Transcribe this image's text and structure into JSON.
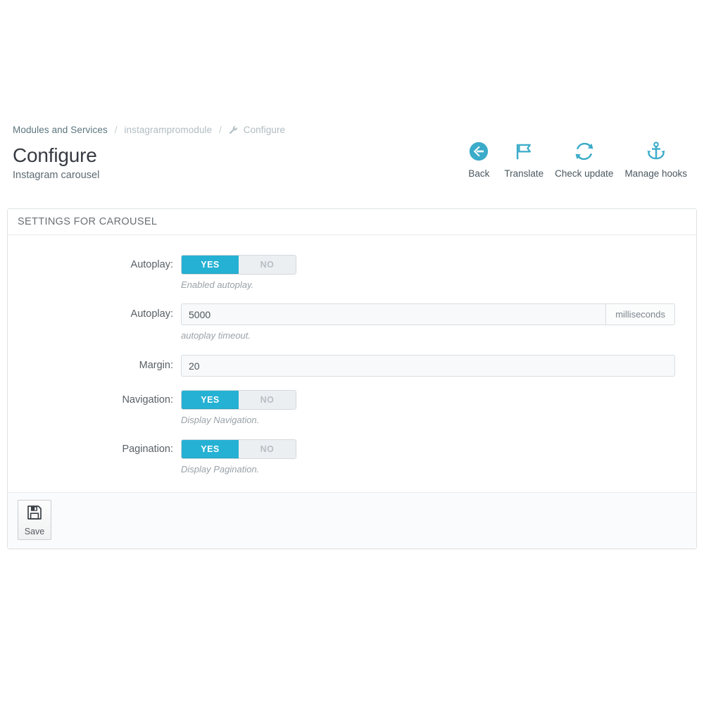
{
  "breadcrumb": {
    "root": "Modules and Services",
    "module": "instagrampromodule",
    "current": "Configure",
    "separator": "/"
  },
  "header": {
    "title": "Configure",
    "subtitle": "Instagram carousel"
  },
  "toolbar": {
    "items": [
      {
        "label": "Back",
        "icon": "back-circle-arrow-icon"
      },
      {
        "label": "Translate",
        "icon": "flag-icon"
      },
      {
        "label": "Check update",
        "icon": "refresh-icon"
      },
      {
        "label": "Manage hooks",
        "icon": "anchor-icon"
      }
    ]
  },
  "panel": {
    "title": "SETTINGS FOR CAROUSEL",
    "rows": [
      {
        "label": "Autoplay:",
        "type": "switch",
        "yes_label": "YES",
        "no_label": "NO",
        "value": "YES",
        "help": "Enabled autoplay."
      },
      {
        "label": "Autoplay:",
        "type": "text-addon",
        "value": "5000",
        "addon": "milliseconds",
        "help": "autoplay timeout."
      },
      {
        "label": "Margin:",
        "type": "text",
        "value": "20",
        "help": ""
      },
      {
        "label": "Navigation:",
        "type": "switch",
        "yes_label": "YES",
        "no_label": "NO",
        "value": "YES",
        "help": "Display Navigation."
      },
      {
        "label": "Pagination:",
        "type": "switch",
        "yes_label": "YES",
        "no_label": "NO",
        "value": "YES",
        "help": "Display Pagination."
      }
    ],
    "save_label": "Save"
  },
  "colors": {
    "accent": "#25b1d3",
    "toolbar_icon": "#3aabc9",
    "panel_border": "#dfe3e6",
    "text": "#585f65"
  }
}
